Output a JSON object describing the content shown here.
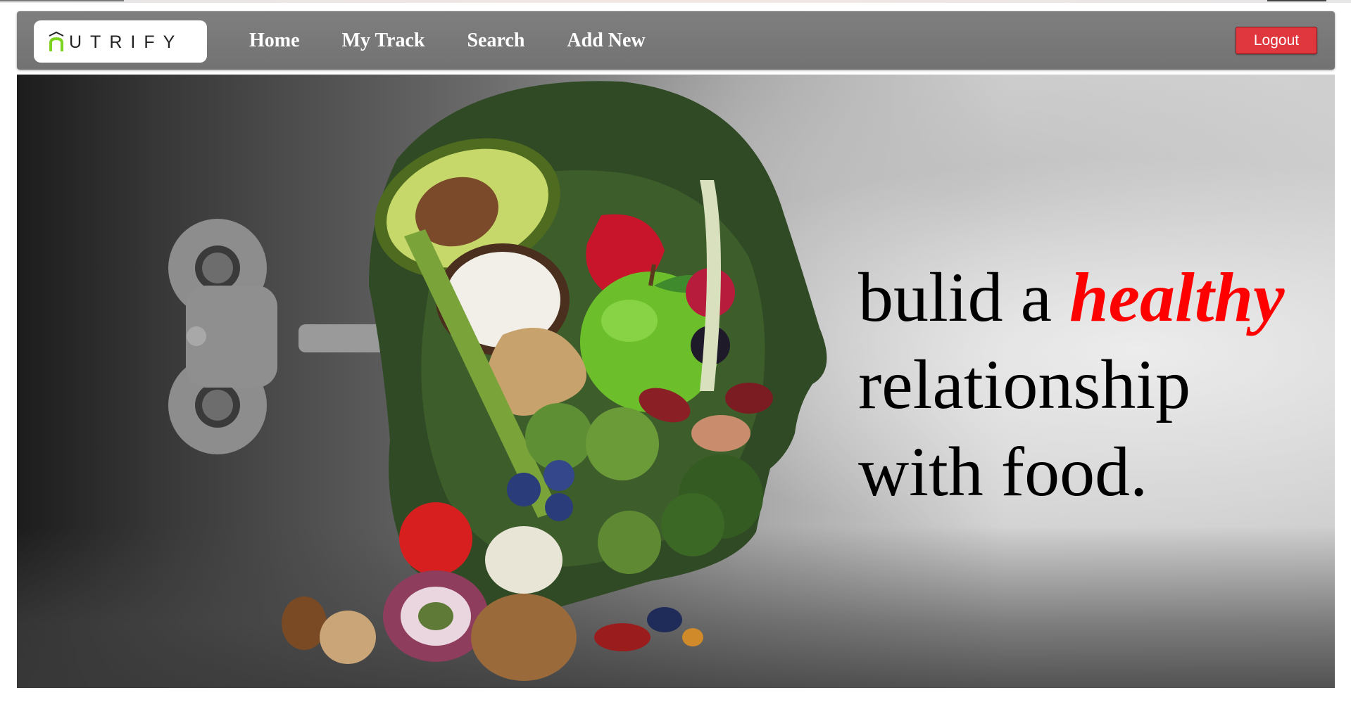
{
  "brand": {
    "logo_text": "UTRIFY",
    "logo_letter_color": "#7ed321"
  },
  "nav": {
    "items": [
      {
        "label": "Home"
      },
      {
        "label": "My Track"
      },
      {
        "label": "Search"
      },
      {
        "label": "Add New"
      }
    ],
    "logout_label": "Logout",
    "logout_color": "#e0373f"
  },
  "hero": {
    "headline_part1": "bulid a",
    "headline_accent": "healthy",
    "headline_line2": "relationship",
    "headline_line3": "with food.",
    "accent_color": "#ff0000",
    "image_subject": "wind-up key in a head made of vegetables and fruit"
  }
}
